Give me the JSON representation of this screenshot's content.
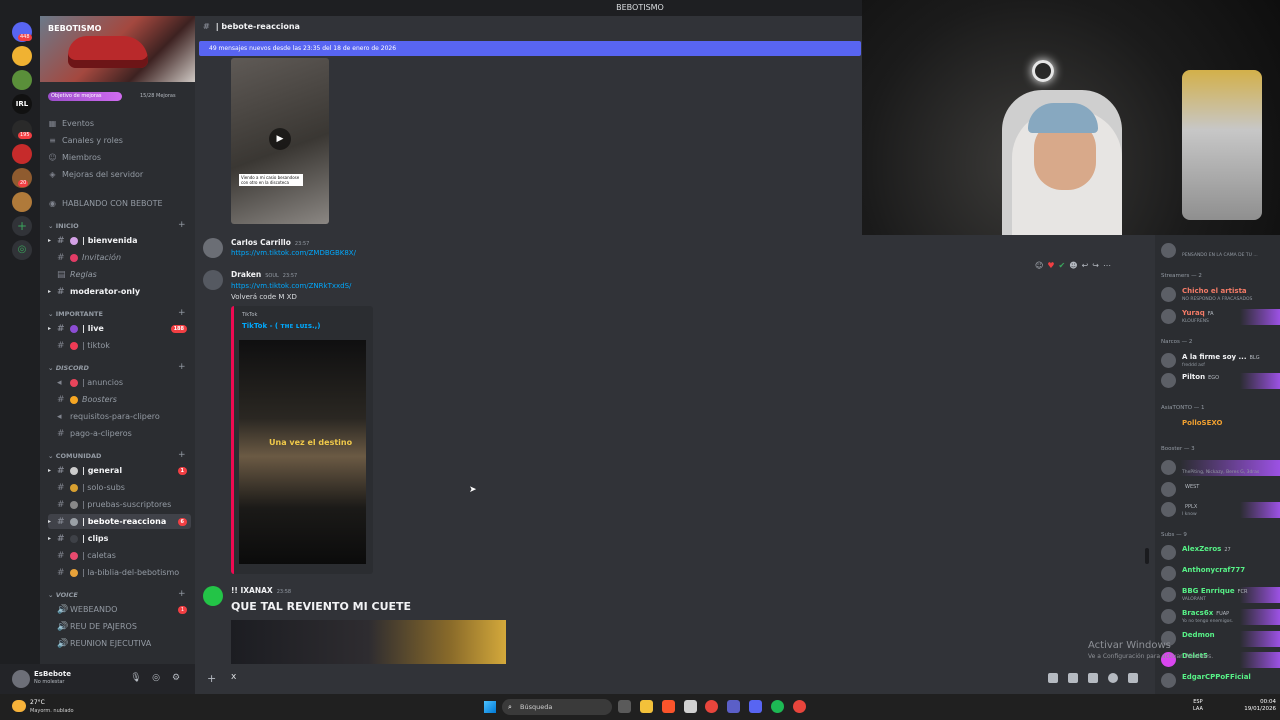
{
  "window": {
    "title": "BEBOTISMO"
  },
  "server": {
    "name": "BEBOTISMO",
    "boost_label": "Objetivo de mejoras",
    "boost_count": "15/28 Mejoras",
    "menu": [
      {
        "label": "Eventos"
      },
      {
        "label": "Canales y roles"
      },
      {
        "label": "Miembros"
      },
      {
        "label": "Mejoras del servidor"
      },
      {
        "label": "HABLANDO CON BEBOTE"
      }
    ],
    "rail_badges": [
      "448",
      "2",
      "195",
      "20"
    ]
  },
  "categories": {
    "inicio": "INICIO",
    "importante": "IMPORTANTE",
    "discord": "DISCORD",
    "comunidad": "COMUNIDAD",
    "voice": "VOICE"
  },
  "channels": {
    "bienvenida": "| bienvenida",
    "invitacion": "Invitación",
    "reglas": "Reglas",
    "moderator": "moderator-only",
    "live": "| live",
    "live_badge": "188",
    "tiktok": "| tiktok",
    "anuncios": "| anuncios",
    "boosters": "Boosters",
    "requisitos": "requisitos-para-clipero",
    "pago": "pago-a-cliperos",
    "general": "| general",
    "general_badge": "1",
    "solo_subs": "| solo-subs",
    "pruebas": "| pruebas-suscriptores",
    "reaccion": "| bebote-reacciona",
    "reaccion_badge": "6",
    "clips": "| clips",
    "caletas": "| caletas",
    "biblia": "| la-biblia-del-bebotismo",
    "webeando": "WEBEANDO",
    "webeando_badge": "1",
    "reu": "REU DE PAJEROS",
    "reunion": "REUNION EJECUTIVA"
  },
  "user": {
    "name": "EsBebote",
    "status": "No molestar"
  },
  "chat": {
    "channel_title": "| bebote-reacciona",
    "new_messages_bar": "49 mensajes nuevos desde las 23:35 del 18 de enero de 2026",
    "video_caption": "Viendo a mi casio besandose con otro en la discoteca",
    "messages": [
      {
        "author": "Carlos Carrillo",
        "time": "23:57",
        "link": "https://vm.tiktok.com/ZMDBGBK8X/"
      },
      {
        "author": "Draken",
        "tag": "SOUL",
        "time": "23:57",
        "link": "https://vm.tiktok.com/ZNRkTxxdS/",
        "text": "Volverá code M XD"
      },
      {
        "author": "!! IXANAX",
        "time": "23:58",
        "text": "QUE TAL REVIENTO MI CUETE"
      }
    ],
    "embed": {
      "provider": "TikTok",
      "title": "TikTok - ( ᴛʜᴇ ʟᴜɪs.,)",
      "overlay": "Una vez el destino"
    },
    "composer_value": "x"
  },
  "members": {
    "top_sub": "PENSANDO EN LA CAMA DE TU ...",
    "streamers_header": "Streamers — 2",
    "streamers": [
      {
        "name": "Chicho el artista",
        "sub": "NO RESPONDO A FRACASADOS",
        "color": "#f47b67"
      },
      {
        "name": "Yuraq",
        "tag": "FA",
        "sub": "KLOUFRENS",
        "color": "#f47b67"
      }
    ],
    "narcos_header": "Narcos — 2",
    "narcos": [
      {
        "name": "A la firme soy ...",
        "tag": "BLG",
        "sub": "freddd asf",
        "color": "#f2f3f5"
      },
      {
        "name": "Pilton",
        "tag": "EGO",
        "color": "#f2f3f5"
      }
    ],
    "asia_header": "AsiaTONTO — 1",
    "asia": [
      {
        "name": "PolloSEXO",
        "color": "#f0a030"
      }
    ],
    "booster_header": "Booster — 3",
    "boosters": [
      {
        "name": "",
        "sub": "ThePiting, Nickazy, Beres G, 3dras",
        "color": "#f47fff"
      },
      {
        "name": "",
        "tag": "WEST",
        "color": "#f47fff"
      },
      {
        "name": "",
        "tag": "PPLX",
        "sub": "I know",
        "color": "#f47fff"
      }
    ],
    "subs_header": "Subs — 9",
    "subs": [
      {
        "name": "AlexZeros",
        "tag": "27",
        "color": "#57f287"
      },
      {
        "name": "Anthonycraf777",
        "color": "#57f287"
      },
      {
        "name": "BBG Enrrique",
        "tag": "FCR",
        "sub": "VALORANT",
        "color": "#57f287"
      },
      {
        "name": "Bracs6x",
        "tag": "FUAP",
        "sub": "Yo no tengo enemigos.",
        "color": "#57f287"
      },
      {
        "name": "Dedmon",
        "color": "#57f287"
      },
      {
        "name": "Delet5",
        "color": "#57f287"
      },
      {
        "name": "EdgarCPPoFFicial",
        "color": "#57f287"
      }
    ],
    "watermark": "Activar Windows",
    "watermark_sub": "Ve a Configuración para activar Windows."
  },
  "taskbar": {
    "temp": "27°C",
    "weather": "Mayorm. nublado",
    "search": "Búsqueda",
    "lang": "ESP",
    "lang_sub": "LAA",
    "time": "00:04",
    "date": "19/01/2026"
  }
}
